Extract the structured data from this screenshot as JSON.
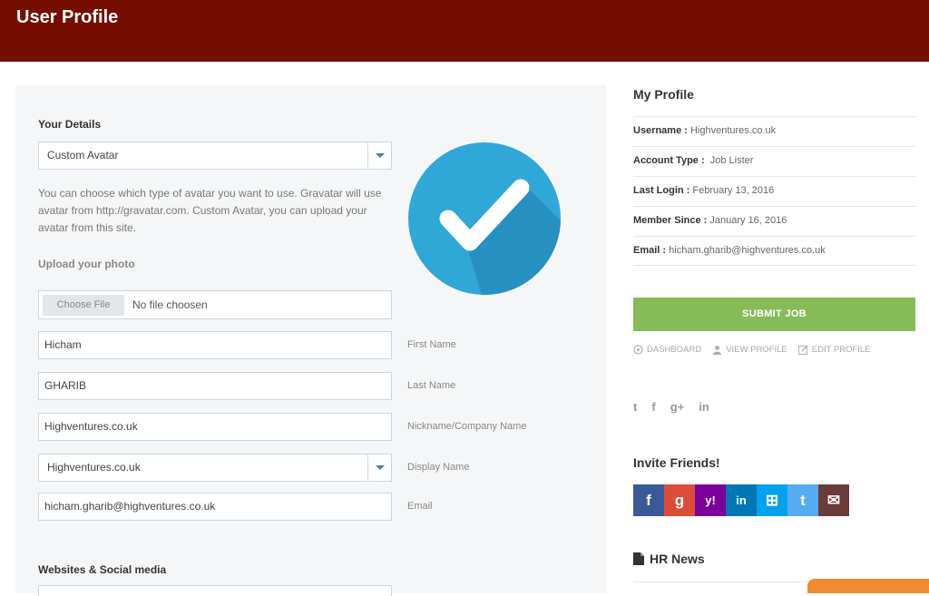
{
  "header": {
    "title": "User Profile"
  },
  "form": {
    "your_details_label": "Your Details",
    "avatar_select_value": "Custom Avatar",
    "avatar_help": "You can choose which type of avatar you want to use. Gravatar will use avatar from http://gravatar.com. Custom Avatar, you can upload your avatar from this site.",
    "upload_label": "Upload your photo",
    "choose_file_label": "Choose File",
    "no_file_text": "No file choosen",
    "first_name_value": "Hicham",
    "first_name_label": "First Name",
    "last_name_value": "GHARIB",
    "last_name_label": "Last Name",
    "nickname_value": "Highventures.co.uk",
    "nickname_label": "Nickname/Company Name",
    "display_name_value": "Highventures.co.uk",
    "display_name_label": "Display Name",
    "email_value": "hicham.gharib@highventures.co.uk",
    "email_label": "Email",
    "websites_label": "Websites & Social media"
  },
  "profile": {
    "title": "My Profile",
    "rows": [
      {
        "key": "Username :",
        "value": "Highventures.co.uk"
      },
      {
        "key": "Account Type :",
        "value": "Job Lister"
      },
      {
        "key": "Last Login :",
        "value": "February 13, 2016"
      },
      {
        "key": "Member Since :",
        "value": "January 16, 2016"
      },
      {
        "key": "Email :",
        "value": "hicham.gharib@highventures.co.uk"
      }
    ],
    "submit_label": "SUBMIT JOB",
    "links": [
      "DASHBOARD",
      "VIEW PROFILE",
      "EDIT PROFILE"
    ],
    "social": [
      "t",
      "f",
      "g+",
      "in"
    ]
  },
  "invite": {
    "title": "Invite Friends!",
    "buttons": [
      {
        "name": "facebook",
        "glyph": "f",
        "color": "#3b5998"
      },
      {
        "name": "google",
        "glyph": "g",
        "color": "#dd4b39"
      },
      {
        "name": "yahoo",
        "glyph": "y!",
        "color": "#7b0099"
      },
      {
        "name": "linkedin",
        "glyph": "in",
        "color": "#0077b5"
      },
      {
        "name": "windows",
        "glyph": "⊞",
        "color": "#00a2ed"
      },
      {
        "name": "twitter",
        "glyph": "t",
        "color": "#55acee"
      },
      {
        "name": "email",
        "glyph": "✉",
        "color": "#6b3a3a"
      }
    ]
  },
  "news": {
    "title": "HR News"
  },
  "colors": {
    "header": "#760e00",
    "submit": "#87bb57",
    "avatar": "#2fa8d8"
  }
}
